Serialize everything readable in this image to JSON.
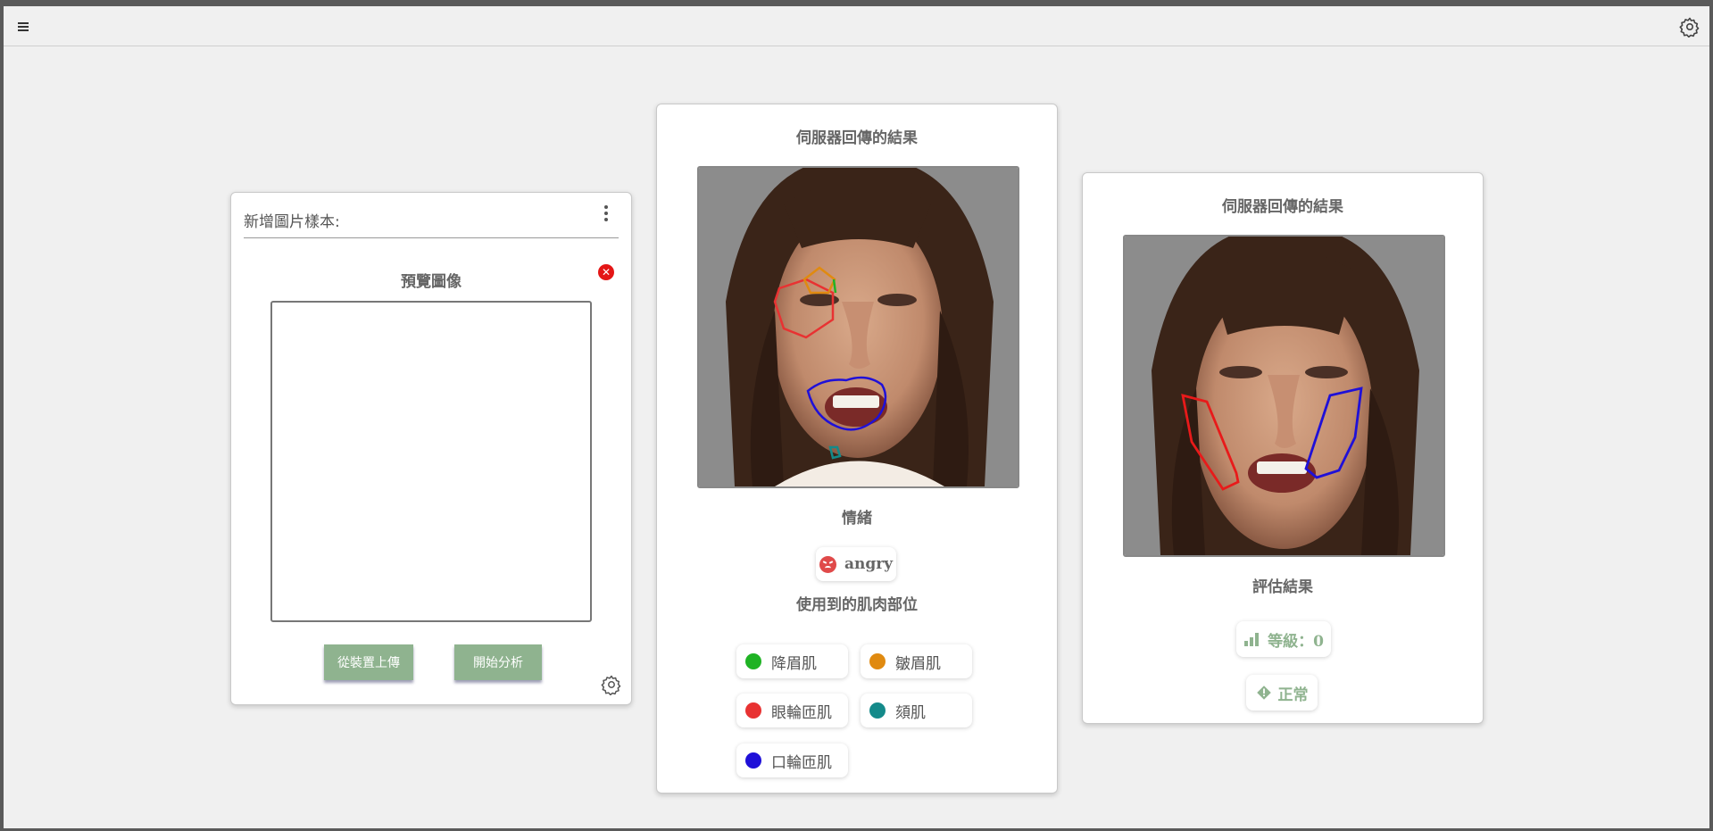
{
  "upload_card": {
    "title": "新增圖片樣本:",
    "preview_label": "預覽圖像",
    "upload_button": "從裝置上傳",
    "analyze_button": "開始分析"
  },
  "result_card_1": {
    "heading": "伺服器回傳的結果",
    "emotion_label": "情緒",
    "emotion_value": "angry",
    "muscles_label": "使用到的肌肉部位",
    "muscles": [
      {
        "label": "降眉肌",
        "color": "#1fb324"
      },
      {
        "label": "皺眉肌",
        "color": "#e08a10"
      },
      {
        "label": "眼輪匝肌",
        "color": "#e83232"
      },
      {
        "label": "頦肌",
        "color": "#148a8a"
      },
      {
        "label": "口輪匝肌",
        "color": "#1f10d8"
      }
    ]
  },
  "result_card_2": {
    "heading": "伺服器回傳的結果",
    "assessment_label": "評估結果",
    "level_text": "等級：0",
    "status_text": "正常"
  },
  "icons": {
    "menu": "hamburger-menu-icon",
    "settings": "gear-icon",
    "more": "kebab-menu-icon",
    "close": "close-circle-icon",
    "emotion": "angry-face-icon",
    "level": "bar-chart-icon",
    "status": "diamond-alert-icon"
  },
  "colors": {
    "accent_green": "#8fb38f",
    "close_red": "#e41616"
  }
}
